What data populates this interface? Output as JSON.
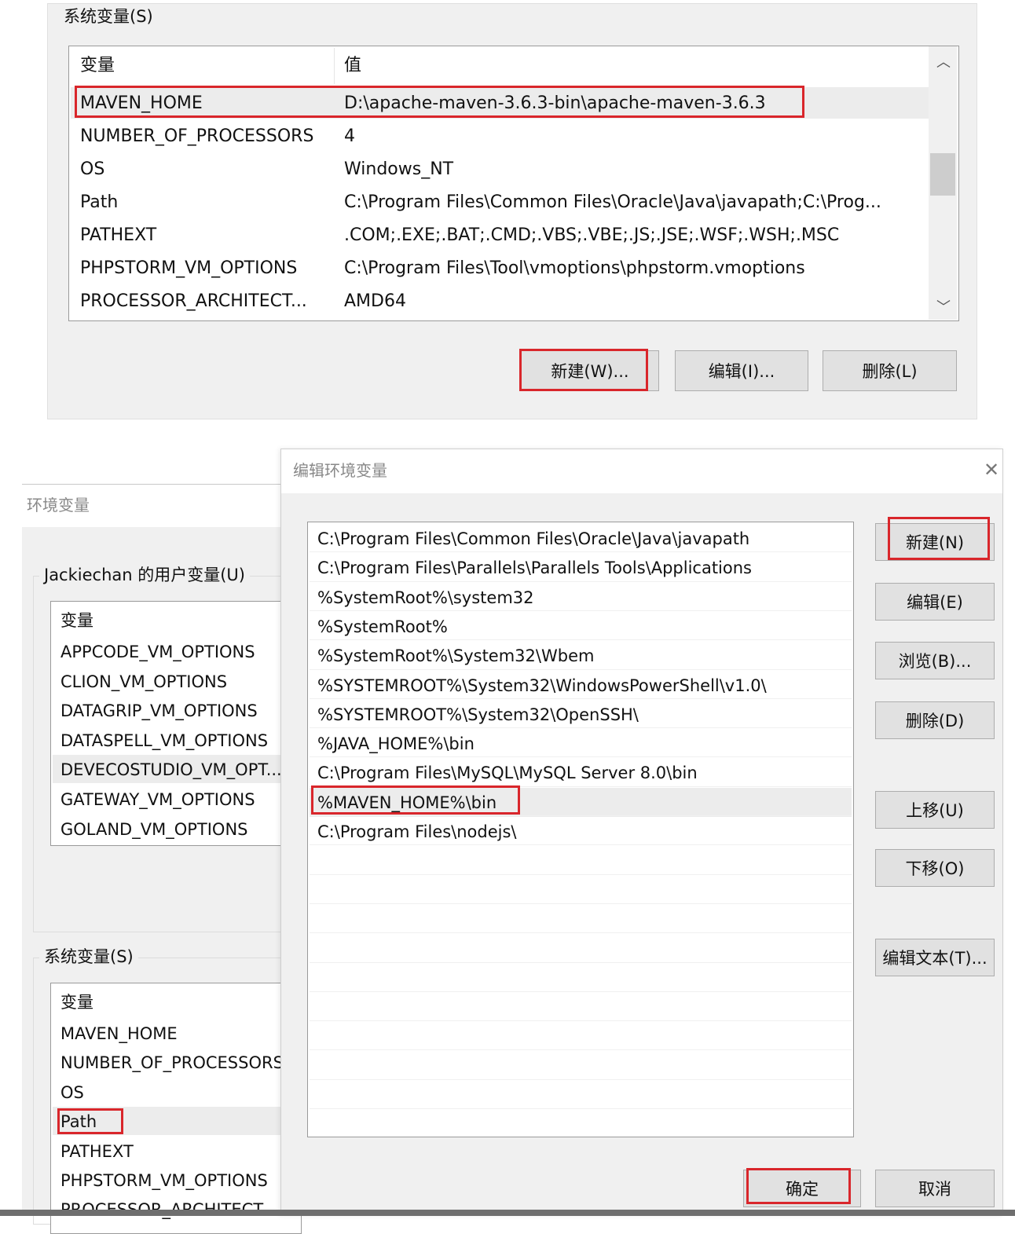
{
  "top_panel": {
    "group_label": "系统变量(S)",
    "columns": [
      "变量",
      "值"
    ],
    "rows": [
      {
        "name": "MAVEN_HOME",
        "value": "D:\\apache-maven-3.6.3-bin\\apache-maven-3.6.3"
      },
      {
        "name": "NUMBER_OF_PROCESSORS",
        "value": "4"
      },
      {
        "name": "OS",
        "value": "Windows_NT"
      },
      {
        "name": "Path",
        "value": "C:\\Program Files\\Common Files\\Oracle\\Java\\javapath;C:\\Prog..."
      },
      {
        "name": "PATHEXT",
        "value": ".COM;.EXE;.BAT;.CMD;.VBS;.VBE;.JS;.JSE;.WSF;.WSH;.MSC"
      },
      {
        "name": "PHPSTORM_VM_OPTIONS",
        "value": "C:\\Program Files\\Tool\\vmoptions\\phpstorm.vmoptions"
      },
      {
        "name": "PROCESSOR_ARCHITECT...",
        "value": "AMD64"
      }
    ],
    "buttons": {
      "new": "新建(W)...",
      "edit": "编辑(I)...",
      "delete": "删除(L)"
    }
  },
  "env_dialog": {
    "title": "环境变量",
    "user_group_label": "Jackiechan 的用户变量(U)",
    "user_column": "变量",
    "user_rows": [
      "APPCODE_VM_OPTIONS",
      "CLION_VM_OPTIONS",
      "DATAGRIP_VM_OPTIONS",
      "DATASPELL_VM_OPTIONS",
      "DEVECOSTUDIO_VM_OPT...",
      "GATEWAY_VM_OPTIONS",
      "GOLAND_VM_OPTIONS"
    ],
    "system_group_label": "系统变量(S)",
    "system_column": "变量",
    "system_rows": [
      "MAVEN_HOME",
      "NUMBER_OF_PROCESSORS",
      "OS",
      "Path",
      "PATHEXT",
      "PHPSTORM_VM_OPTIONS",
      "PROCESSOR_ARCHITECT..."
    ]
  },
  "edit_dialog": {
    "title": "编辑环境变量",
    "close_icon": "close-icon",
    "entries": [
      "C:\\Program Files\\Common Files\\Oracle\\Java\\javapath",
      "C:\\Program Files\\Parallels\\Parallels Tools\\Applications",
      "%SystemRoot%\\system32",
      "%SystemRoot%",
      "%SystemRoot%\\System32\\Wbem",
      "%SYSTEMROOT%\\System32\\WindowsPowerShell\\v1.0\\",
      "%SYSTEMROOT%\\System32\\OpenSSH\\",
      "%JAVA_HOME%\\bin",
      "C:\\Program Files\\MySQL\\MySQL Server 8.0\\bin",
      "%MAVEN_HOME%\\bin",
      "C:\\Program Files\\nodejs\\"
    ],
    "buttons": {
      "new": "新建(N)",
      "edit": "编辑(E)",
      "browse": "浏览(B)...",
      "delete": "删除(D)",
      "up": "上移(U)",
      "down": "下移(O)",
      "edit_text": "编辑文本(T)...",
      "ok": "确定",
      "cancel": "取消"
    }
  },
  "colors": {
    "highlight": "#d9262b",
    "panel": "#f0f0f0"
  }
}
